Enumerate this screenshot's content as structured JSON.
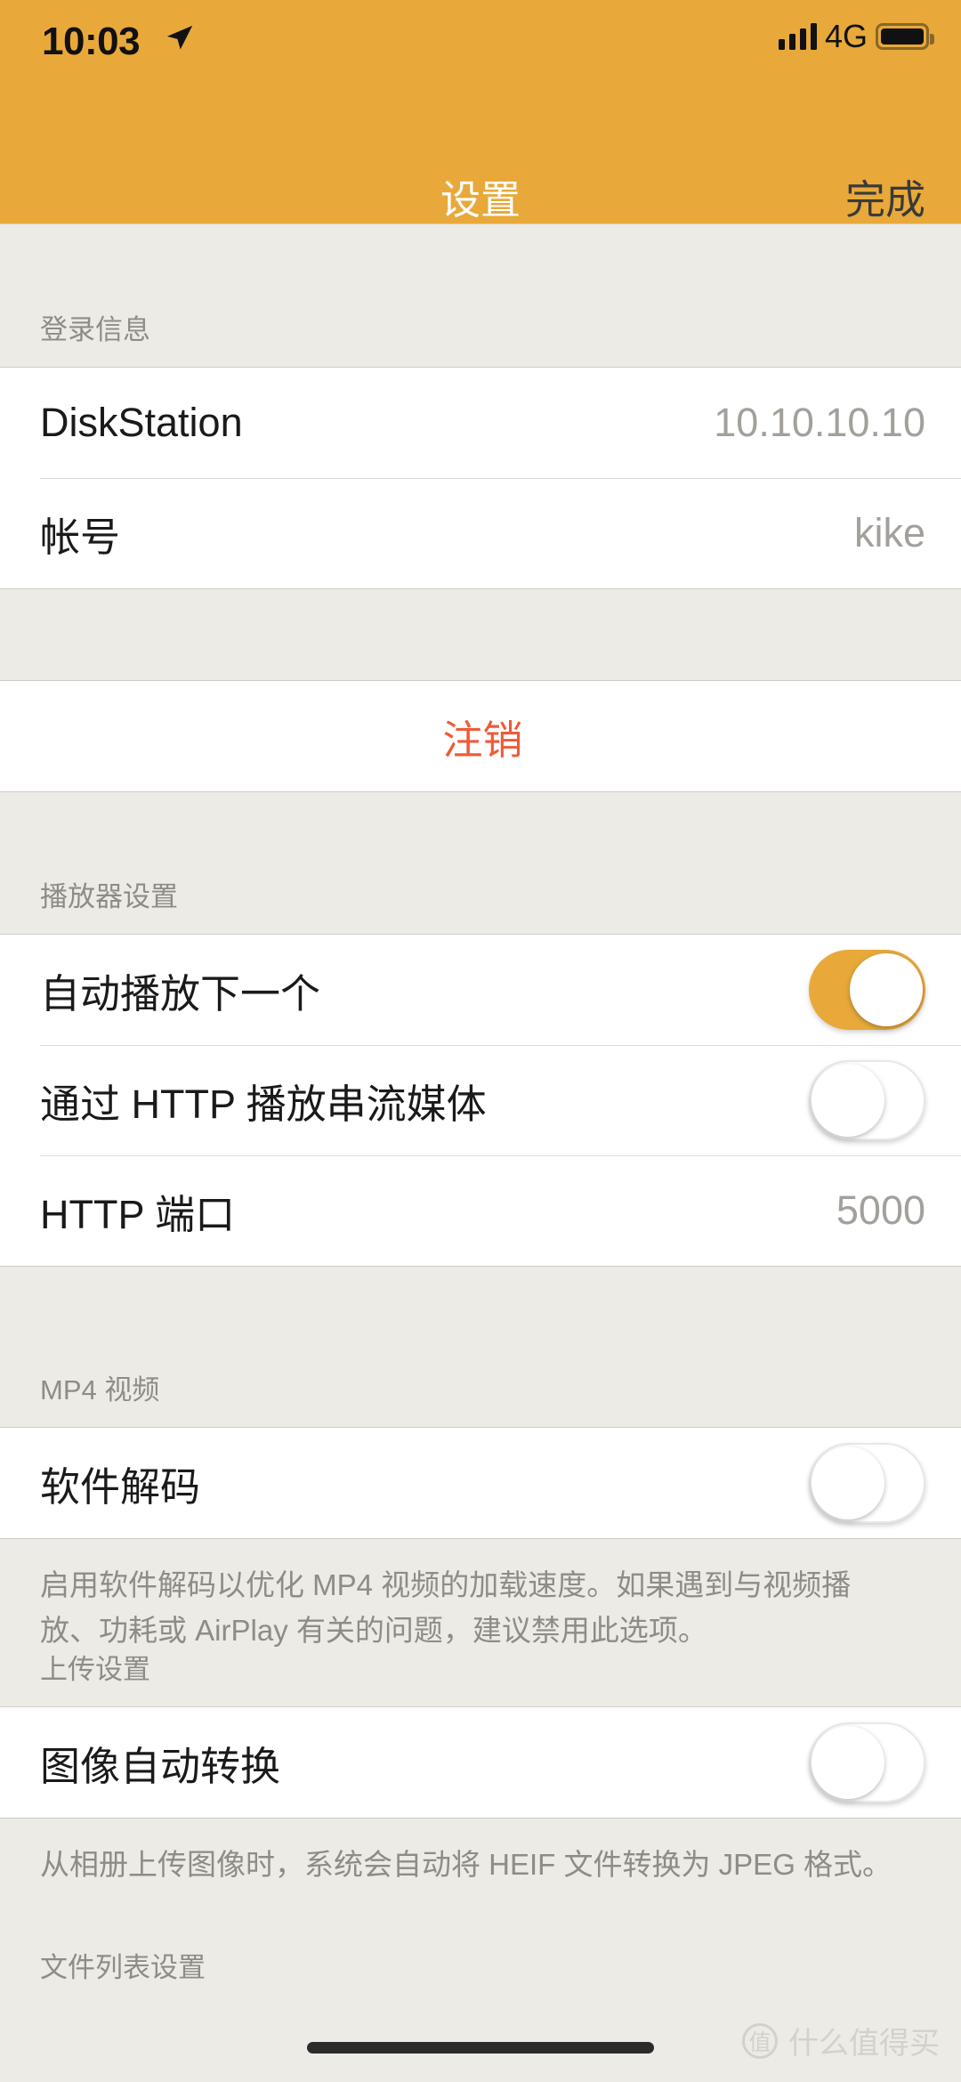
{
  "status_bar": {
    "time": "10:03",
    "location_icon": "location-arrow-icon",
    "signal_icon": "signal-bars-icon",
    "network": "4G",
    "battery_icon": "battery-full-icon"
  },
  "nav": {
    "title": "设置",
    "done_label": "完成"
  },
  "sections": {
    "login": {
      "header": "登录信息",
      "rows": [
        {
          "label": "DiskStation",
          "value": "10.10.10.10"
        },
        {
          "label": "帐号",
          "value": "kike"
        }
      ]
    },
    "logout": {
      "label": "注销",
      "color": "#EE5B36"
    },
    "player": {
      "header": "播放器设置",
      "rows": [
        {
          "label": "自动播放下一个",
          "toggle": "on"
        },
        {
          "label": "通过 HTTP 播放串流媒体",
          "toggle": "off"
        },
        {
          "label": "HTTP 端口",
          "value": "5000"
        }
      ]
    },
    "mp4": {
      "header": "MP4 视频",
      "rows": [
        {
          "label": "软件解码",
          "toggle": "off"
        }
      ],
      "footnote": "启用软件解码以优化 MP4 视频的加载速度。如果遇到与视频播放、功耗或 AirPlay 有关的问题，建议禁用此选项。"
    },
    "upload": {
      "header": "上传设置",
      "rows": [
        {
          "label": "图像自动转换",
          "toggle": "off"
        }
      ],
      "footnote": "从相册上传图像时，系统会自动将 HEIF 文件转换为 JPEG 格式。"
    },
    "filelist": {
      "header": "文件列表设置"
    }
  },
  "watermark": {
    "badge": "值",
    "text": "什么值得买"
  },
  "theme": {
    "accent": "#E8A93A",
    "page_bg": "#EDEBE5",
    "row_bg": "#FFFFFF",
    "danger": "#EE5B36"
  }
}
